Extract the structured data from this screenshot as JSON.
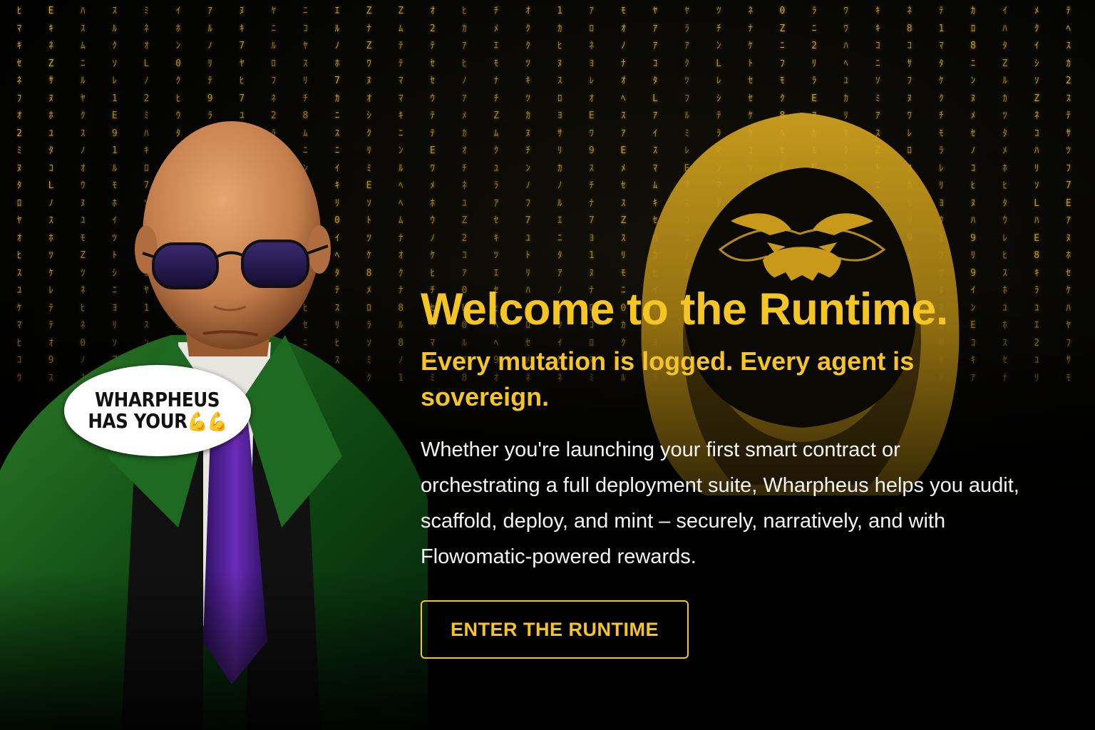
{
  "hero": {
    "title": "Welcome to the Runtime.",
    "subtitle": "Every mutation is logged. Every agent is sovereign.",
    "body": "Whether you're launching your first smart contract or orchestrating a full deployment suite, Wharpheus helps you audit, scaffold, deploy, and mint – securely, narratively, and with Flowomatic-powered rewards.",
    "cta_label": "ENTER THE RUNTIME"
  },
  "speech_bubble": {
    "line1": "WHARPHEUS",
    "line2": "HAS YOUR",
    "emoji": "💪💪"
  },
  "colors": {
    "accent": "#f5c523",
    "background": "#000000",
    "body_text": "#f4f4f4",
    "code_rain": "#d8b020"
  },
  "icons": {
    "emblem": "hooded-gorilla-icon",
    "background": "matrix-code-rain"
  }
}
